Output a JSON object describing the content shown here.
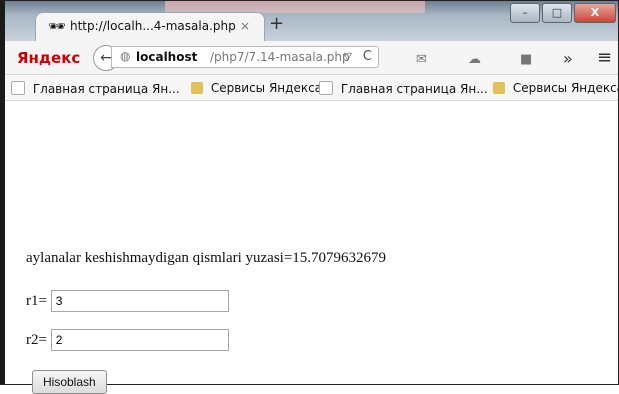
{
  "browser": {
    "tab": {
      "title": "http://localh...4-masala.php",
      "close": "×"
    },
    "new_tab": "+",
    "window_buttons": [
      "–",
      "□",
      "X"
    ],
    "nav": {
      "brand": "Яндекс",
      "back_icon": "←",
      "url_host": "localhost",
      "url_path": "/php7/7.14-masala.php",
      "url_dropdown": "▽",
      "reload_icon": "C",
      "overflow": "»",
      "menu": "≡"
    },
    "bookmarks": [
      {
        "label": "Главная страница Ян...",
        "type": "page"
      },
      {
        "label": "Сервисы Яндекса",
        "type": "folder"
      },
      {
        "label": "Главная страница Ян...",
        "type": "page"
      },
      {
        "label": "Сервисы Яндекса",
        "type": "folder"
      }
    ]
  },
  "page": {
    "result_text": "aylanalar keshishmaydigan qismlari yuzasi=15.7079632679",
    "fields": [
      {
        "label": "r1=",
        "value": "3"
      },
      {
        "label": "r2=",
        "value": "2"
      }
    ],
    "submit_label": "Hisoblash"
  }
}
